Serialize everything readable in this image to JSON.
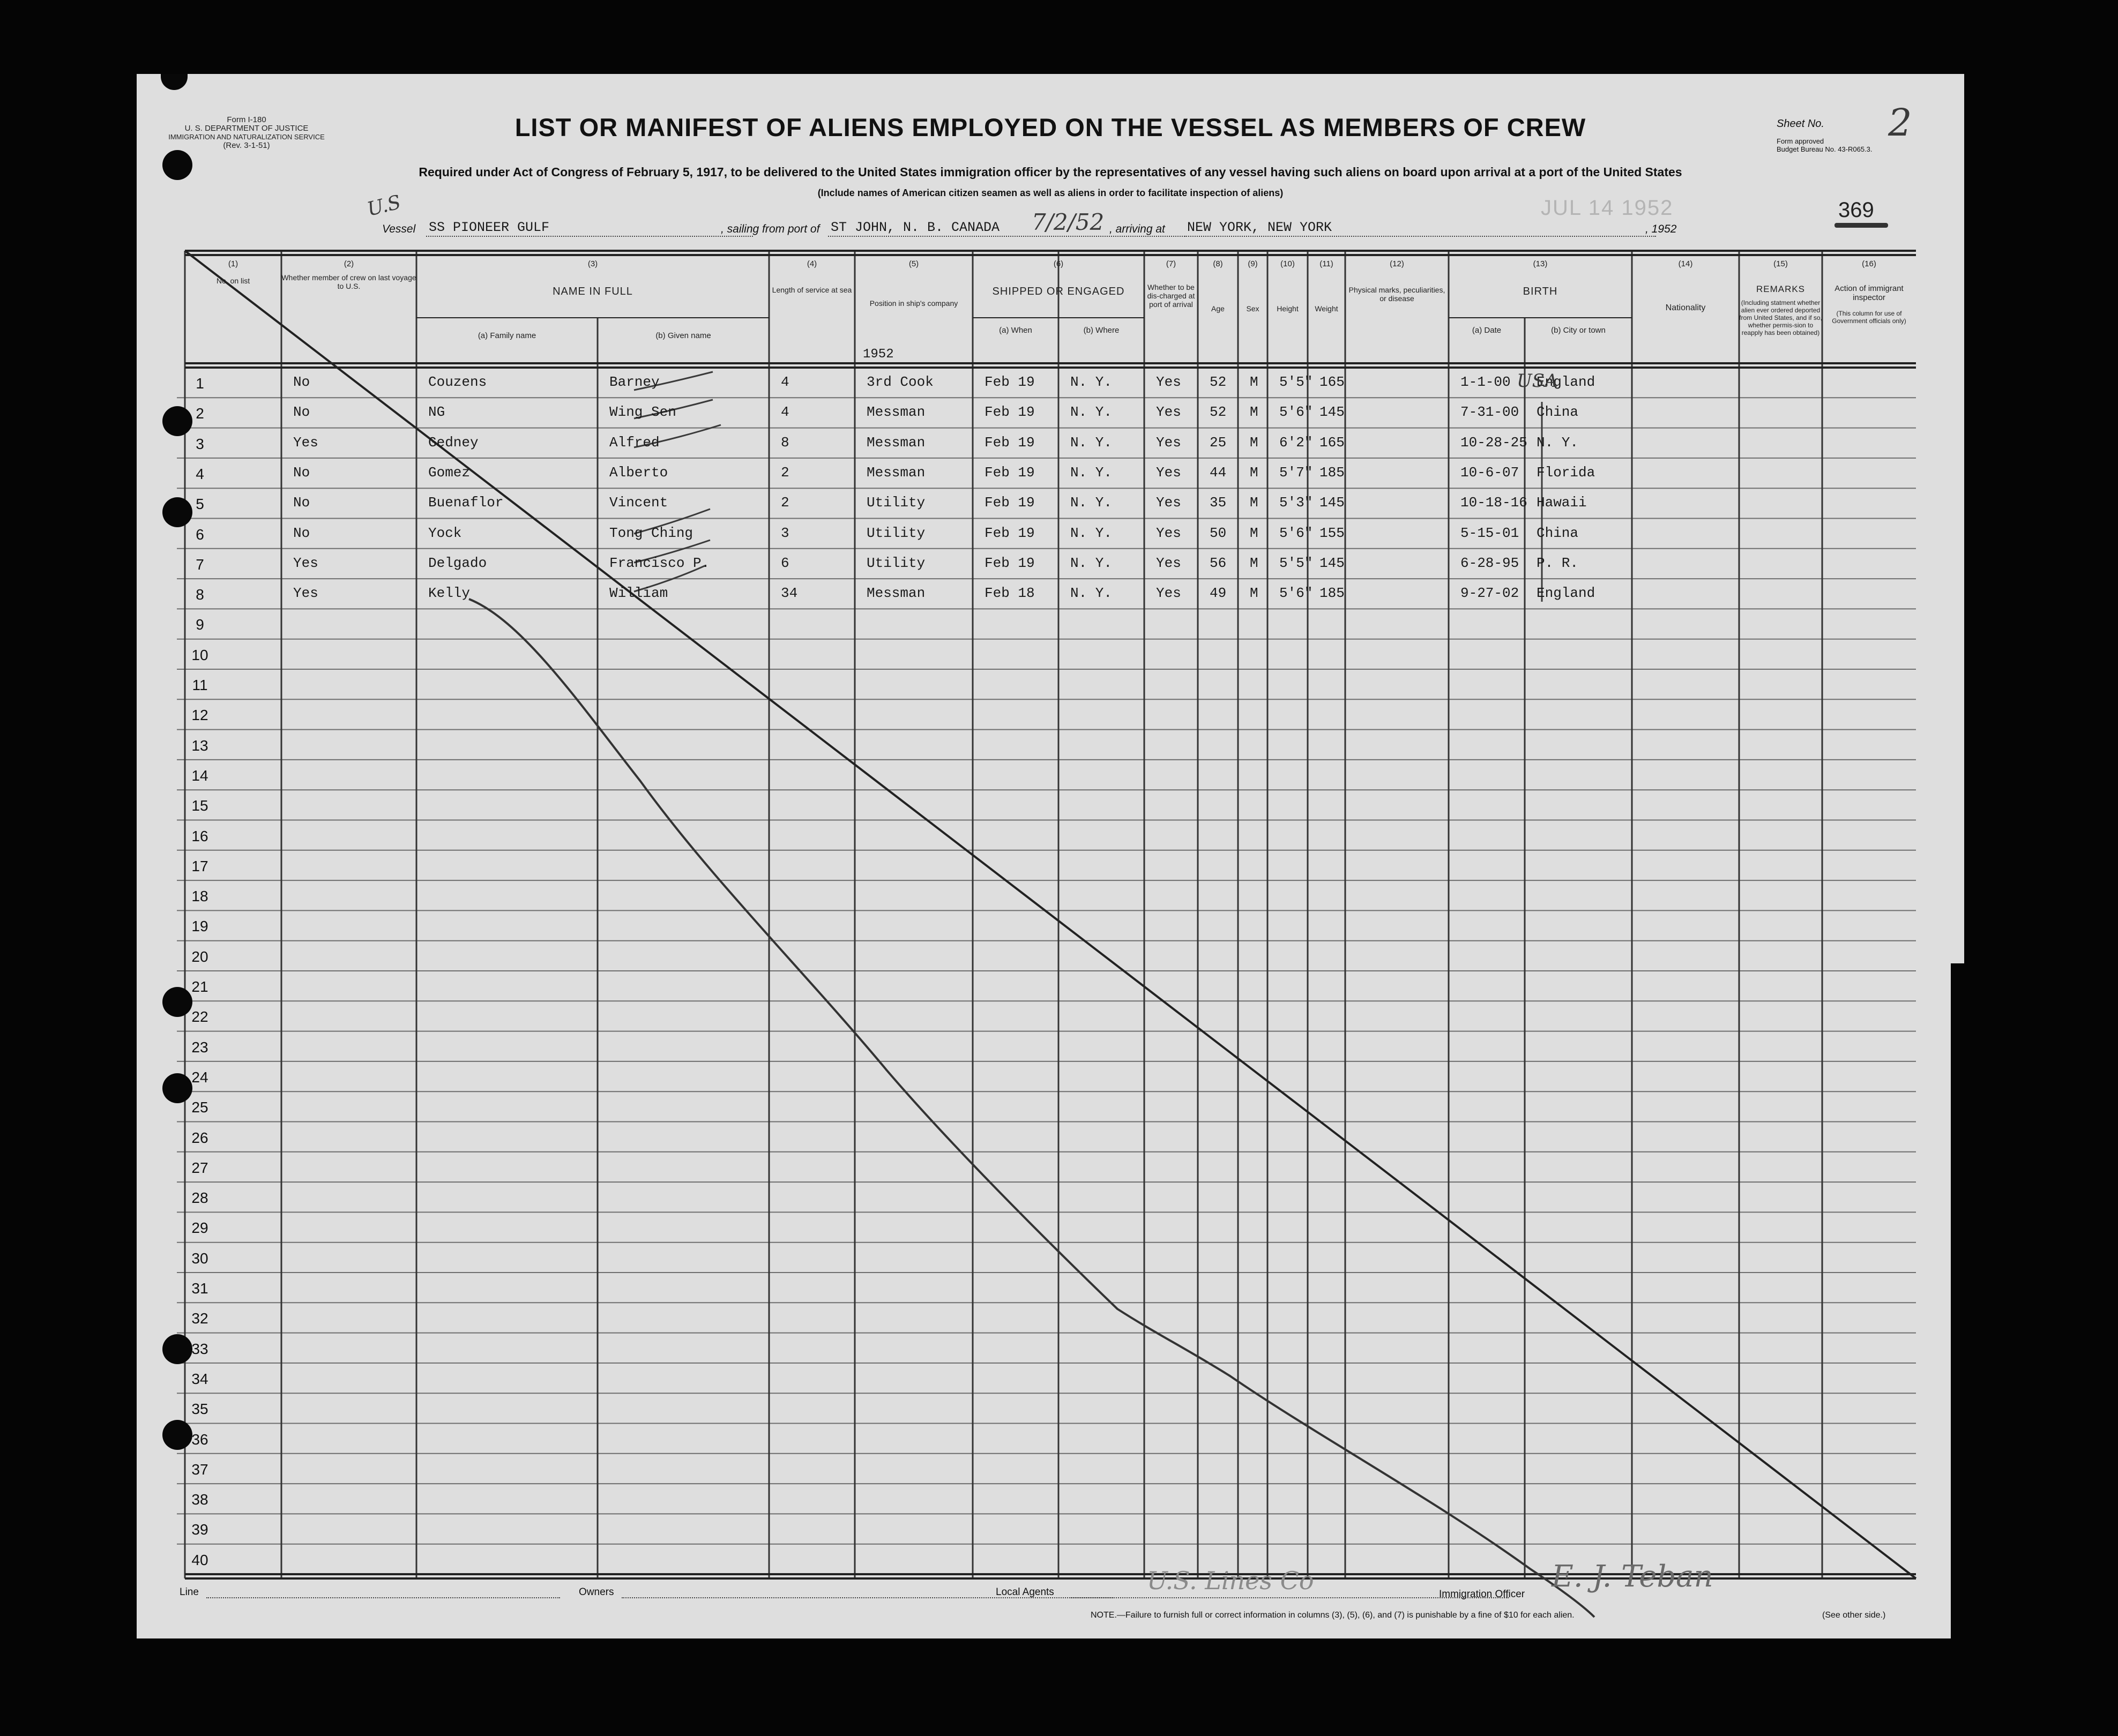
{
  "form": {
    "form_id": "Form I-180",
    "department": "U. S. DEPARTMENT OF JUSTICE",
    "service": "IMMIGRATION AND NATURALIZATION SERVICE",
    "revision": "(Rev. 3-1-51)",
    "title": "LIST OR MANIFEST OF ALIENS EMPLOYED ON THE VESSEL AS MEMBERS OF CREW",
    "subtitle": "Required under Act of Congress of February 5, 1917, to be delivered to the United States immigration officer by the representatives of any vessel having such aliens on board upon arrival at a port of the United States",
    "subtitle2": "(Include names of American citizen seamen as well as aliens in order to facilitate inspection of aliens)",
    "sheet_label": "Sheet No.",
    "sheet_no": "2",
    "approval_line1": "Form approved",
    "approval_line2": "Budget Bureau No. 43-R065.3.",
    "stamp_date": "JUL 14 1952",
    "stamp_number": "369"
  },
  "vessel": {
    "us_mark": "U.S",
    "vessel_label": "Vessel",
    "vessel_name": "SS PIONEER GULF",
    "sailing_label": ", sailing from port of",
    "port": "ST JOHN, N. B. CANADA",
    "handwritten_date": "7/2/52",
    "arriving_label": ", arriving at",
    "arriving_port": "NEW YORK, NEW YORK",
    "year_suffix": ", 1952"
  },
  "columns": {
    "c1_num": "(1)",
    "c1": "No. on list",
    "c2_num": "(2)",
    "c2": "Whether member of crew on last voyage to U.S.",
    "c3_num": "(3)",
    "c3": "NAME IN FULL",
    "c3a": "(a) Family name",
    "c3b": "(b) Given name",
    "c4_num": "(4)",
    "c4": "Length of service at sea",
    "c5_num": "(5)",
    "c5": "Position in ship's company",
    "c6_num": "(6)",
    "c6": "SHIPPED OR ENGAGED",
    "c6a": "(a) When",
    "c6a_year": "1952",
    "c6b": "(b) Where",
    "c7_num": "(7)",
    "c7": "Whether to be dis-charged at port of arrival",
    "c8_num": "(8)",
    "c8": "Age",
    "c9_num": "(9)",
    "c9": "Sex",
    "c10_num": "(10)",
    "c10": "Height",
    "c11_num": "(11)",
    "c11": "Weight",
    "c12_num": "(12)",
    "c12": "Physical marks, peculiarities, or disease",
    "c13_num": "(13)",
    "c13": "BIRTH",
    "c13a": "(a) Date",
    "c13b": "(b) City or town",
    "c14_num": "(14)",
    "c14": "Nationality",
    "c15_num": "(15)",
    "c15": "REMARKS",
    "c15_note": "(Including statment whether alien ever ordered deported from United States, and if so, whether permis-sion to reapply has been obtained)",
    "c16_num": "(16)",
    "c16": "Action of immigrant inspector",
    "c16_note": "(This column for use of Government officials only)"
  },
  "rows": [
    {
      "no": "1",
      "last": "No",
      "family": "Couzens",
      "given": "Barney",
      "service": "4",
      "position": "3rd Cook",
      "when": "Feb 19",
      "where": "N. Y.",
      "discharged": "Yes",
      "age": "52",
      "sex": "M",
      "height": "5'5\"",
      "weight": "165",
      "bdate": "1-1-00",
      "city": "England"
    },
    {
      "no": "2",
      "last": "No",
      "family": "NG",
      "given": "Wing Sen",
      "service": "4",
      "position": "Messman",
      "when": "Feb 19",
      "where": "N. Y.",
      "discharged": "Yes",
      "age": "52",
      "sex": "M",
      "height": "5'6\"",
      "weight": "145",
      "bdate": "7-31-00",
      "city": "China"
    },
    {
      "no": "3",
      "last": "Yes",
      "family": "Gedney",
      "given": "Alfred",
      "service": "8",
      "position": "Messman",
      "when": "Feb 19",
      "where": "N. Y.",
      "discharged": "Yes",
      "age": "25",
      "sex": "M",
      "height": "6'2\"",
      "weight": "165",
      "bdate": "10-28-25",
      "city": "N. Y."
    },
    {
      "no": "4",
      "last": "No",
      "family": "Gomez",
      "given": "Alberto",
      "service": "2",
      "position": "Messman",
      "when": "Feb 19",
      "where": "N. Y.",
      "discharged": "Yes",
      "age": "44",
      "sex": "M",
      "height": "5'7\"",
      "weight": "185",
      "bdate": "10-6-07",
      "city": "Florida"
    },
    {
      "no": "5",
      "last": "No",
      "family": "Buenaflor",
      "given": "Vincent",
      "service": "2",
      "position": "Utility",
      "when": "Feb 19",
      "where": "N. Y.",
      "discharged": "Yes",
      "age": "35",
      "sex": "M",
      "height": "5'3\"",
      "weight": "145",
      "bdate": "10-18-16",
      "city": "Hawaii"
    },
    {
      "no": "6",
      "last": "No",
      "family": "Yock",
      "given": "Tong Ching",
      "service": "3",
      "position": "Utility",
      "when": "Feb 19",
      "where": "N. Y.",
      "discharged": "Yes",
      "age": "50",
      "sex": "M",
      "height": "5'6\"",
      "weight": "155",
      "bdate": "5-15-01",
      "city": "China"
    },
    {
      "no": "7",
      "last": "Yes",
      "family": "Delgado",
      "given": "Francisco P.",
      "service": "6",
      "position": "Utility",
      "when": "Feb 19",
      "where": "N. Y.",
      "discharged": "Yes",
      "age": "56",
      "sex": "M",
      "height": "5'5\"",
      "weight": "145",
      "bdate": "6-28-95",
      "city": "P. R."
    },
    {
      "no": "8",
      "last": "Yes",
      "family": "Kelly",
      "given": "William",
      "service": "34",
      "position": "Messman",
      "when": "Feb 18",
      "where": "N. Y.",
      "discharged": "Yes",
      "age": "49",
      "sex": "M",
      "height": "5'6\"",
      "weight": "185",
      "bdate": "9-27-02",
      "city": "England"
    }
  ],
  "row_numbers": [
    "1",
    "2",
    "3",
    "4",
    "5",
    "6",
    "7",
    "8",
    "9",
    "10",
    "11",
    "12",
    "13",
    "14",
    "15",
    "16",
    "17",
    "18",
    "19",
    "20",
    "21",
    "22",
    "23",
    "24",
    "25",
    "26",
    "27",
    "28",
    "29",
    "30",
    "31",
    "32",
    "33",
    "34",
    "35",
    "36",
    "37",
    "38",
    "39",
    "40"
  ],
  "nationality_handwritten": "USA",
  "footer": {
    "line_label": "Line",
    "owners_label": "Owners",
    "agents_label": "Local Agents",
    "agents_value": "U.S. Lines Co",
    "officer_label": "Immigration Officer",
    "officer_signature": "E. J. Teban",
    "note": "NOTE.—Failure to furnish full or correct information in columns (3), (5), (6), and (7) is punishable by a fine of $10 for each alien.",
    "see_other": "(See other side.)"
  }
}
